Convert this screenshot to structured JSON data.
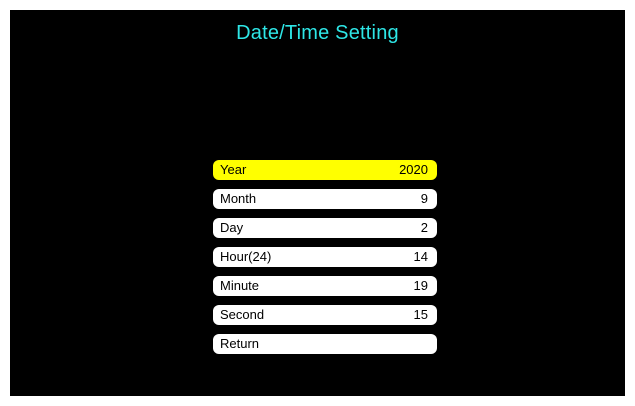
{
  "title": "Date/Time Setting",
  "colors": {
    "background": "#000000",
    "title": "#2ee6e6",
    "row_default": "#ffffff",
    "row_selected": "#ffff00"
  },
  "menu": {
    "selected_index": 0,
    "items": [
      {
        "label": "Year",
        "value": "2020"
      },
      {
        "label": "Month",
        "value": "9"
      },
      {
        "label": "Day",
        "value": "2"
      },
      {
        "label": "Hour(24)",
        "value": "14"
      },
      {
        "label": "Minute",
        "value": "19"
      },
      {
        "label": "Second",
        "value": "15"
      },
      {
        "label": "Return",
        "value": ""
      }
    ]
  }
}
